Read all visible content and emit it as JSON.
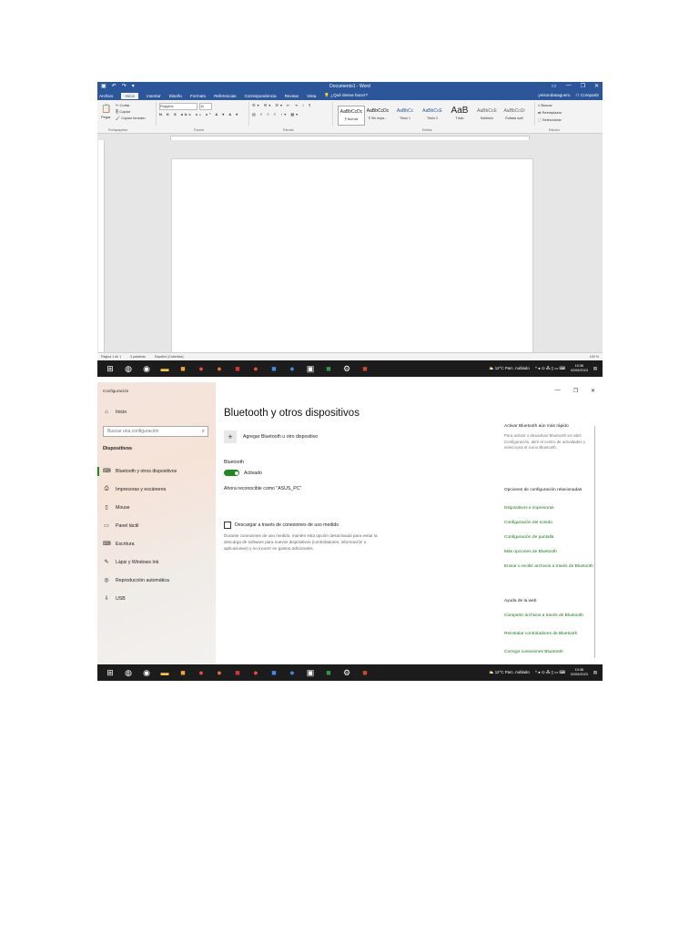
{
  "word": {
    "title": "Documento1 - Word",
    "tabs": [
      "Archivo",
      "Inicio",
      "Insertar",
      "Diseño",
      "Formato",
      "Referencias",
      "Correspondencia",
      "Revisar",
      "Vista"
    ],
    "tell_me": "¿Qué desea hacer?",
    "user": "yeisondasaguero",
    "share": "Compartir",
    "clipboard": {
      "paste": "Pegar",
      "cut": "Cortar",
      "copy": "Copiar",
      "format_painter": "Copiar formato",
      "label": "Portapapeles"
    },
    "font": {
      "name": "Poppins",
      "size": "11",
      "label": "Fuente"
    },
    "paragraph_label": "Párrafo",
    "styles": [
      {
        "preview": "AaBbCcDc",
        "name": "¶ Normal"
      },
      {
        "preview": "AaBbCcDc",
        "name": "¶ Sin espa..."
      },
      {
        "preview": "AaBbCc",
        "name": "Título 1"
      },
      {
        "preview": "AaBbCcE",
        "name": "Título 2"
      },
      {
        "preview": "AaB",
        "name": "Título"
      },
      {
        "preview": "AaBbCcE",
        "name": "Subtítulo"
      },
      {
        "preview": "AaBbCcDi",
        "name": "Énfasis sutil"
      }
    ],
    "styles_label": "Estilos",
    "editing": {
      "find": "Buscar",
      "replace": "Reemplazar",
      "select": "Seleccionar",
      "label": "Edición"
    },
    "status": {
      "page": "Página 1 de 1",
      "words": "0 palabras",
      "lang": "Español (Colombia)",
      "zoom": "100 %"
    }
  },
  "taskbar": {
    "weather": "12°C Parc. nublado",
    "time": "10:36",
    "date": "02/05/2023"
  },
  "settings": {
    "app_title": "Configuración",
    "home": "Inicio",
    "search_placeholder": "Buscar una configuración",
    "section": "Dispositivos",
    "nav": [
      {
        "label": "Bluetooth y otros dispositivos",
        "icon": "bluetooth-devices-icon",
        "glyph": "⌨"
      },
      {
        "label": "Impresoras y escáneres",
        "icon": "printer-icon",
        "glyph": "⎙"
      },
      {
        "label": "Mouse",
        "icon": "mouse-icon",
        "glyph": "▯"
      },
      {
        "label": "Panel táctil",
        "icon": "touchpad-icon",
        "glyph": "▭"
      },
      {
        "label": "Escritura",
        "icon": "keyboard-icon",
        "glyph": "⌨"
      },
      {
        "label": "Lápiz y Windows Ink",
        "icon": "pen-icon",
        "glyph": "✎"
      },
      {
        "label": "Reproducción automática",
        "icon": "autoplay-icon",
        "glyph": "◎"
      },
      {
        "label": "USB",
        "icon": "usb-icon",
        "glyph": "⇩"
      }
    ],
    "heading": "Bluetooth y otros dispositivos",
    "add_device": "Agregar Bluetooth u otro dispositivo",
    "bt_label": "Bluetooth",
    "bt_state": "Activado",
    "discoverable": "Ahora reconocible como \"ASUS_PC\"",
    "metered_label": "Descargar a través de conexiones de uso medido",
    "metered_desc": "Durante conexiones de uso medido, mantén esta opción desactivada para evitar la descarga de software para nuevos dispositivos (controladores, información o aplicaciones) y no incurrir en gastos adicionales.",
    "right": {
      "quick_head": "Activar Bluetooth aún más rápido",
      "quick_text": "Para activar o desactivar Bluetooth sin abrir Configuración, abre el centro de actividades y selecciona el icono Bluetooth.",
      "related_head": "Opciones de configuración relacionadas",
      "related_links": [
        "Dispositivos e impresoras",
        "Configuración del sonido",
        "Configuración de pantalla",
        "Más opciones de Bluetooth",
        "Enviar o recibir archivos a través de Bluetooth"
      ],
      "help_head": "Ayuda de la web",
      "help_links": [
        "Compartir archivos a través de Bluetooth",
        "Reinstalar controladores de Bluetooth",
        "Corregir conexiones Bluetooth"
      ]
    }
  },
  "colors": {
    "word_blue": "#2b579a",
    "accent_green": "#1d8a1d",
    "taskbar": "#1c1c1c"
  }
}
